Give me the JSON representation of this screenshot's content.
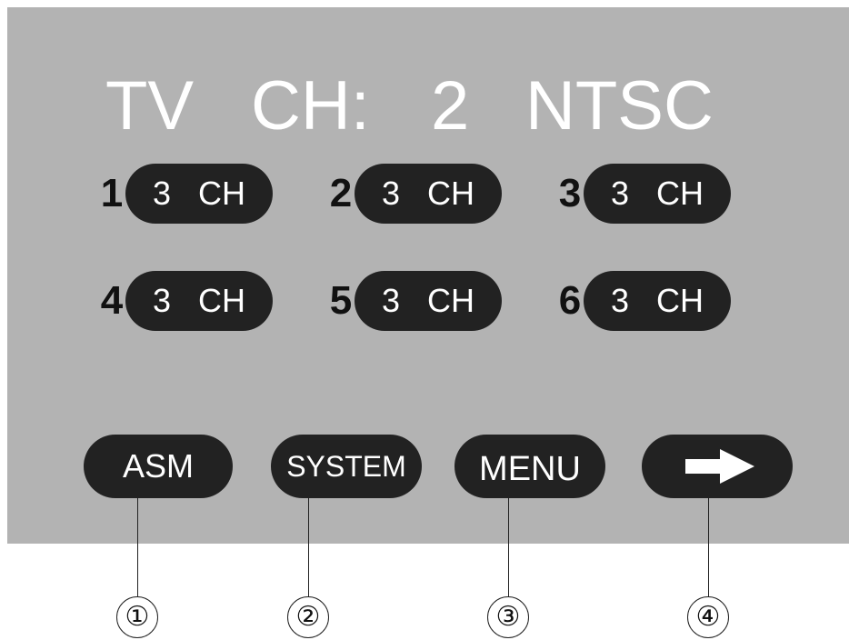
{
  "status": {
    "mode": "TV",
    "channel_label": "CH:",
    "channel": "2",
    "system": "NTSC"
  },
  "presets": [
    {
      "number": "1",
      "label": "3 CH"
    },
    {
      "number": "2",
      "label": "3 CH"
    },
    {
      "number": "3",
      "label": "3 CH"
    },
    {
      "number": "4",
      "label": "3 CH"
    },
    {
      "number": "5",
      "label": "3 CH"
    },
    {
      "number": "6",
      "label": "3 CH"
    }
  ],
  "buttons": {
    "asm": "ASM",
    "system": "SYSTEM",
    "menu": "MENU",
    "next_icon": "arrow-right-icon"
  },
  "callouts": [
    "①",
    "②",
    "③",
    "④"
  ],
  "colors": {
    "screen": "#b3b3b3",
    "button": "#222222",
    "text": "#ffffff"
  }
}
